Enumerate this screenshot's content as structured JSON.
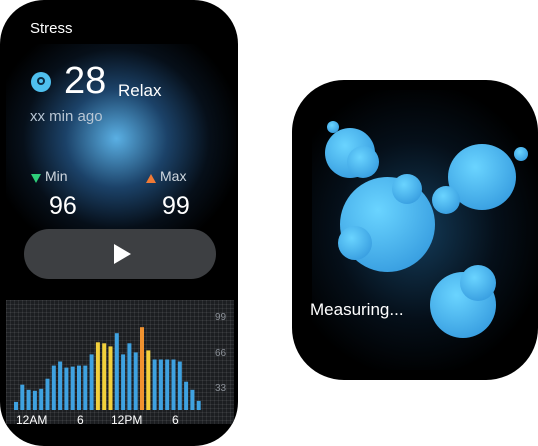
{
  "stress_screen": {
    "title": "Stress",
    "value": "28",
    "status": "Relax",
    "last_measured": "xx min ago",
    "min_label": "Min",
    "min_value": "96",
    "max_label": "Max",
    "max_value": "99",
    "play_icon": "play-icon",
    "chart_y_labels": [
      "99",
      "66",
      "33"
    ],
    "chart_x_labels": [
      "12AM",
      "6",
      "12PM",
      "6"
    ]
  },
  "chart_data": {
    "type": "bar",
    "xlabel": "",
    "ylabel": "",
    "ylim": [
      0,
      99
    ],
    "x_ticks": [
      "12AM",
      "6",
      "12PM",
      "6"
    ],
    "y_ticks": [
      "99",
      "66",
      "33"
    ],
    "values": [
      8,
      25,
      20,
      19,
      21,
      31,
      44,
      48,
      42,
      43,
      44,
      44,
      55,
      67,
      66,
      63,
      76,
      55,
      66,
      57,
      82,
      59,
      50,
      50,
      50,
      50,
      48,
      28,
      20,
      9
    ],
    "colors": [
      "#3fa2e0",
      "#3fa2e0",
      "#3fa2e0",
      "#3fa2e0",
      "#3fa2e0",
      "#3fa2e0",
      "#3fa2e0",
      "#3fa2e0",
      "#3fa2e0",
      "#3fa2e0",
      "#3fa2e0",
      "#3fa2e0",
      "#3fa2e0",
      "#f2d03c",
      "#f2d03c",
      "#f2d03c",
      "#3fa2e0",
      "#3fa2e0",
      "#3fa2e0",
      "#3fa2e0",
      "#f0922f",
      "#f2d03c",
      "#3fa2e0",
      "#3fa2e0",
      "#3fa2e0",
      "#3fa2e0",
      "#3fa2e0",
      "#3fa2e0",
      "#3fa2e0",
      "#3fa2e0"
    ]
  },
  "measuring_screen": {
    "status_text": "Measuring..."
  },
  "colors": {
    "accent": "#3fa2e0",
    "min_indicator": "#2ecf7a",
    "max_indicator": "#f07a35",
    "high_bar": "#f0922f",
    "mid_bar": "#f2d03c"
  }
}
